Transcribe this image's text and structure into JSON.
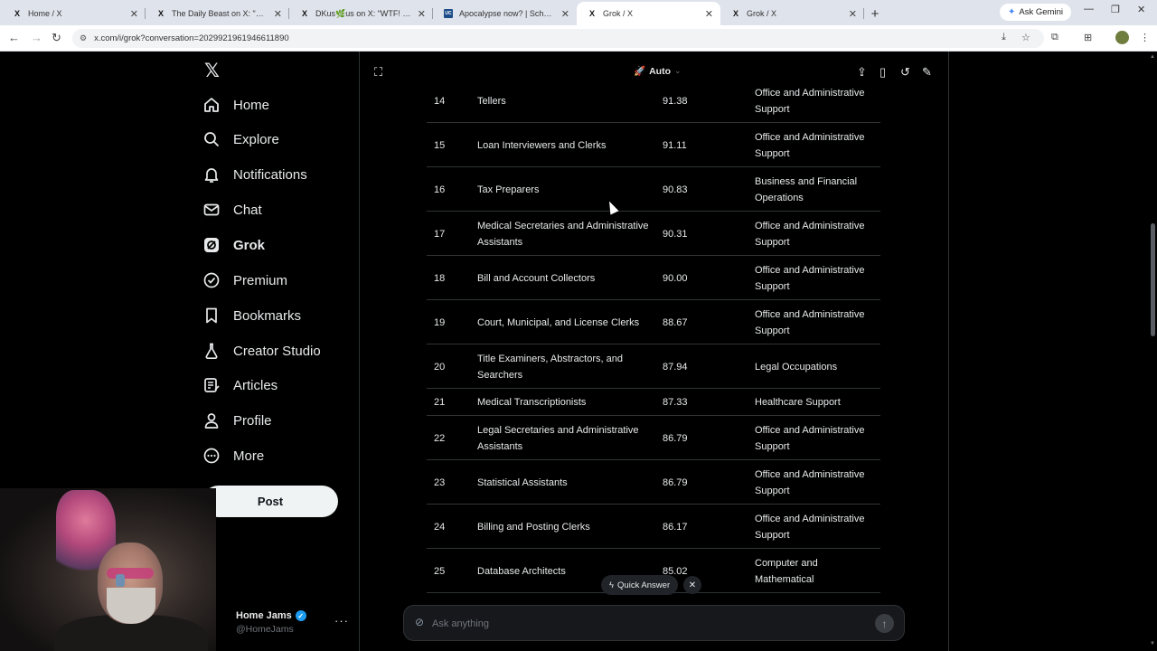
{
  "browser": {
    "tabs": [
      {
        "title": "Home / X",
        "favicon": "X",
        "active": false
      },
      {
        "title": "The Daily Beast on X: \"The fam",
        "favicon": "X",
        "active": false
      },
      {
        "title": "DKus🌿us on X: \"WTF! - Welco",
        "favicon": "X",
        "active": false
      },
      {
        "title": "Apocalypse now? | School of Sc",
        "favicon": "UC",
        "active": false
      },
      {
        "title": "Grok / X",
        "favicon": "X",
        "active": true
      },
      {
        "title": "Grok / X",
        "favicon": "X",
        "active": false
      }
    ],
    "new_tab": "+",
    "gemini_label": "Ask Gemini",
    "url": "x.com/i/grok?conversation=2029921961946611890"
  },
  "sidebar": {
    "logo": "𝕏",
    "items": [
      {
        "label": "Home",
        "icon": "home-icon"
      },
      {
        "label": "Explore",
        "icon": "search-icon"
      },
      {
        "label": "Notifications",
        "icon": "bell-icon"
      },
      {
        "label": "Chat",
        "icon": "mail-icon"
      },
      {
        "label": "Grok",
        "icon": "grok-icon",
        "active": true
      },
      {
        "label": "Premium",
        "icon": "premium-icon"
      },
      {
        "label": "Bookmarks",
        "icon": "bookmark-icon"
      },
      {
        "label": "Creator Studio",
        "icon": "flask-icon"
      },
      {
        "label": "Articles",
        "icon": "article-icon"
      },
      {
        "label": "Profile",
        "icon": "person-icon"
      },
      {
        "label": "More",
        "icon": "more-circle-icon"
      }
    ],
    "post_label": "Post",
    "profile": {
      "name": "Home Jams",
      "handle": "@HomeJams"
    }
  },
  "grok": {
    "model": "Auto",
    "table": [
      {
        "rank": "14",
        "occupation": "Tellers",
        "score": "91.38",
        "category": "Office and Administrative Support"
      },
      {
        "rank": "15",
        "occupation": "Loan Interviewers and Clerks",
        "score": "91.11",
        "category": "Office and Administrative Support"
      },
      {
        "rank": "16",
        "occupation": "Tax Preparers",
        "score": "90.83",
        "category": "Business and Financial Operations"
      },
      {
        "rank": "17",
        "occupation": "Medical Secretaries and Administrative Assistants",
        "score": "90.31",
        "category": "Office and Administrative Support"
      },
      {
        "rank": "18",
        "occupation": "Bill and Account Collectors",
        "score": "90.00",
        "category": "Office and Administrative Support"
      },
      {
        "rank": "19",
        "occupation": "Court, Municipal, and License Clerks",
        "score": "88.67",
        "category": "Office and Administrative Support"
      },
      {
        "rank": "20",
        "occupation": "Title Examiners, Abstractors, and Searchers",
        "score": "87.94",
        "category": "Legal Occupations"
      },
      {
        "rank": "21",
        "occupation": "Medical Transcriptionists",
        "score": "87.33",
        "category": "Healthcare Support"
      },
      {
        "rank": "22",
        "occupation": "Legal Secretaries and Administrative Assistants",
        "score": "86.79",
        "category": "Office and Administrative Support"
      },
      {
        "rank": "23",
        "occupation": "Statistical Assistants",
        "score": "86.79",
        "category": "Office and Administrative Support"
      },
      {
        "rank": "24",
        "occupation": "Billing and Posting Clerks",
        "score": "86.17",
        "category": "Office and Administrative Support"
      },
      {
        "rank": "25",
        "occupation": "Database Architects",
        "score": "85.02",
        "category": "Computer and Mathematical"
      }
    ],
    "quick_answer": "Quick Answer",
    "ask_placeholder": "Ask anything"
  }
}
